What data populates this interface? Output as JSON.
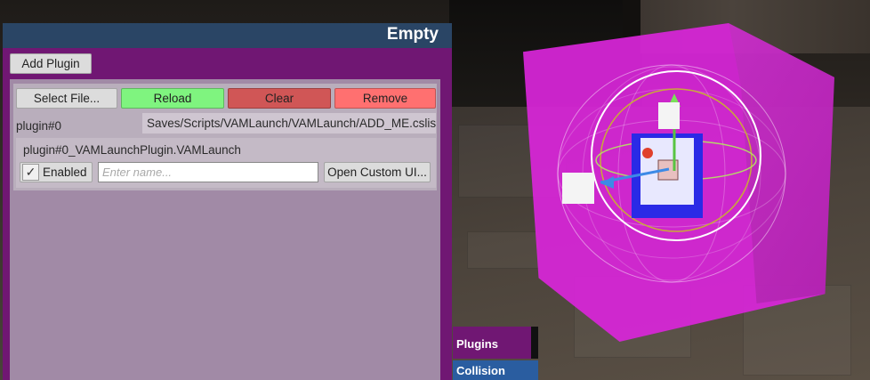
{
  "panel": {
    "title": "Empty",
    "add_plugin_label": "Add Plugin"
  },
  "plugin": {
    "select_file_label": "Select File...",
    "reload_label": "Reload",
    "clear_label": "Clear",
    "remove_label": "Remove",
    "id": "plugin#0",
    "path": "Saves/Scripts/VAMLaunch/VAMLaunch/ADD_ME.cslist",
    "script_name": "plugin#0_VAMLaunchPlugin.VAMLaunch",
    "enabled_label": "Enabled",
    "enabled": true,
    "name_placeholder": "Enter name...",
    "name_value": "",
    "open_custom_ui_label": "Open Custom UI..."
  },
  "side_tabs": {
    "plugins": "Plugins",
    "collision": "Collision Trigger"
  },
  "colors": {
    "panel_bg": "#701773",
    "header_bg": "#2a4565",
    "reload": "#7ff47f",
    "clear": "#d05656",
    "remove": "#ff7070",
    "cube": "#d826d8"
  }
}
